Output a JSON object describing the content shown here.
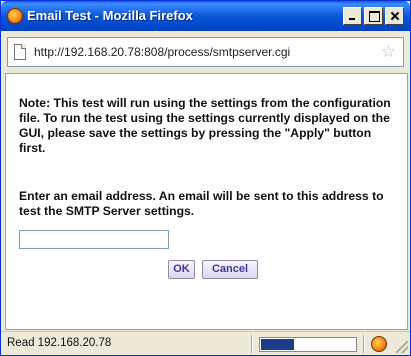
{
  "window": {
    "title": "Email Test - Mozilla Firefox"
  },
  "address_bar": {
    "url": "http://192.168.20.78:808/process/smtpserver.cgi"
  },
  "main": {
    "note": "Note: This test will run using the settings from the configuration file. To run the test using the settings currently displayed on the GUI, please save the settings by pressing the \"Apply\" button first.",
    "prompt": "Enter an email address. An email will be sent to this address to test the SMTP Server settings.",
    "email_value": "",
    "ok_label": "OK",
    "cancel_label": "Cancel"
  },
  "status_bar": {
    "text": "Read 192.168.20.78",
    "progress": 0.35
  },
  "colors": {
    "titlebar": "#0a57d8",
    "button_text": "#3b3b9a",
    "progress_fill": "#1c3d8a"
  },
  "icons": {
    "title": "firefox-icon",
    "page": "page-icon",
    "bookmark": "star-icon",
    "status": "firefox-icon"
  }
}
